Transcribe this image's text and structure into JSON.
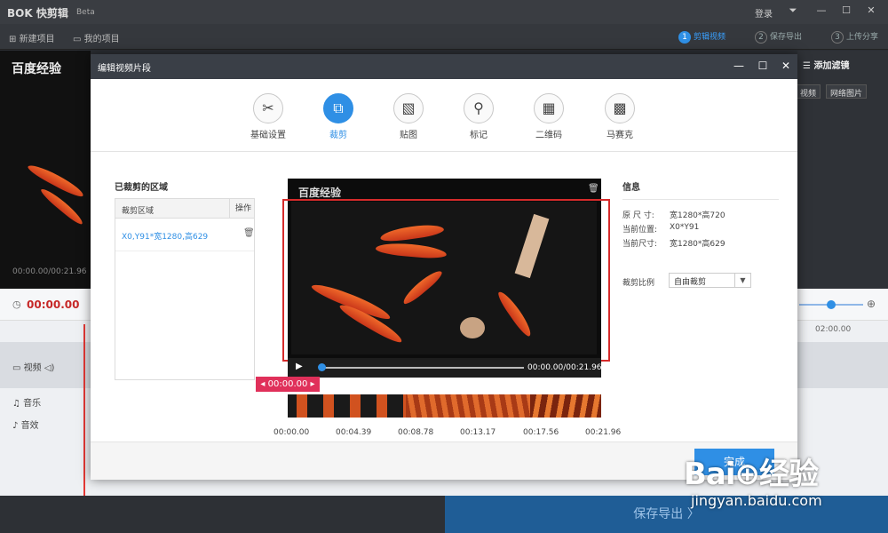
{
  "app": {
    "logo": "BOK 快剪辑",
    "beta": "Beta",
    "login": "登录",
    "controls": [
      "⏷",
      "—",
      "☐",
      "✕"
    ]
  },
  "toolbar": {
    "new_project": "新建项目",
    "my_projects": "我的项目",
    "steps": [
      {
        "num": "1",
        "label": "剪辑视频",
        "active": true
      },
      {
        "num": "2",
        "label": "保存导出",
        "active": false
      },
      {
        "num": "3",
        "label": "上传分享",
        "active": false
      }
    ]
  },
  "background": {
    "preview_title": "百度经验",
    "preview_time": "00:00.00/00:21.96",
    "add_filter": "添加滤镜",
    "video_btn": "视频",
    "net_image_btn": "网络图片",
    "timecode": "00:00.00",
    "ruler_label": "02:00.00",
    "tracks": [
      "视频",
      "音乐",
      "音效"
    ],
    "save_export": "保存导出 〉"
  },
  "modal": {
    "title": "编辑视频片段",
    "tools": [
      {
        "label": "基础设置",
        "icon": "scissors-icon",
        "glyph": "✂",
        "active": false
      },
      {
        "label": "裁剪",
        "icon": "crop-icon",
        "glyph": "⧉",
        "active": true
      },
      {
        "label": "贴图",
        "icon": "image-icon",
        "glyph": "▧",
        "active": false
      },
      {
        "label": "标记",
        "icon": "pin-icon",
        "glyph": "⚲",
        "active": false
      },
      {
        "label": "二维码",
        "icon": "qrcode-icon",
        "glyph": "▦",
        "active": false
      },
      {
        "label": "马赛克",
        "icon": "mosaic-icon",
        "glyph": "▩",
        "active": false
      }
    ],
    "cropped_areas_title": "已裁剪的区域",
    "table_headers": [
      "裁剪区域",
      "操作"
    ],
    "table_rows": [
      {
        "area": "X0,Y91*宽1280,高629"
      }
    ],
    "video_title": "百度经验",
    "video_time": "00:00.00/00:21.96",
    "current_time_pill": "00:00.00",
    "strip_ticks": [
      "00:00.00",
      "00:04.39",
      "00:08.78",
      "00:13.17",
      "00:17.56",
      "00:21.96"
    ],
    "info": {
      "title": "信息",
      "rows": [
        {
          "label": "原 尺 寸:",
          "value": "宽1280*高720"
        },
        {
          "label": "当前位置:",
          "value": "X0*Y91"
        },
        {
          "label": "当前尺寸:",
          "value": "宽1280*高629"
        }
      ],
      "ratio_label": "裁剪比例",
      "ratio_value": "自由裁剪"
    },
    "done": "完成"
  },
  "watermark": {
    "logo": "Bai⊕经验",
    "site": "jingyan.baidu.com"
  }
}
